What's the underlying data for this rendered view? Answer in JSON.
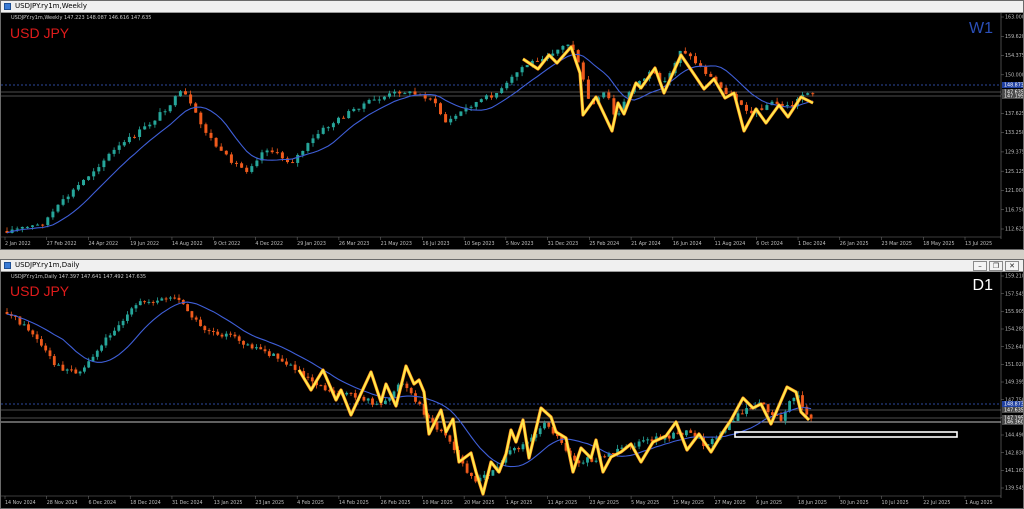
{
  "weekly": {
    "title": "USDJPY.ry1m,Weekly",
    "info": "USDJPY.ry1m,Weekly  147.223 148.087 146.616 147.635",
    "symbol": "USD JPY",
    "timeframe": "W1",
    "timeframe_color": "#2b4fb8",
    "price_labels": [
      "163.000",
      "159.620",
      "154.375",
      "150.000",
      "142.000",
      "137.625",
      "133.250",
      "129.375",
      "125.125",
      "121.000",
      "116.750",
      "112.625"
    ],
    "date_labels": [
      "2 Jan 2022",
      "27 Feb 2022",
      "24 Apr 2022",
      "19 Jun 2022",
      "14 Aug 2022",
      "9 Oct 2022",
      "4 Dec 2022",
      "29 Jan 2023",
      "26 Mar 2023",
      "21 May 2023",
      "16 Jul 2023",
      "10 Sep 2023",
      "5 Nov 2023",
      "31 Dec 2023",
      "25 Feb 2024",
      "21 Apr 2024",
      "16 Jun 2024",
      "11 Aug 2024",
      "6 Oct 2024",
      "1 Dec 2024",
      "26 Jan 2025",
      "23 Mar 2025",
      "18 May 2025",
      "13 Jul 2025"
    ],
    "tags": [
      {
        "text": "148.873",
        "color": "#1e3fa0"
      },
      {
        "text": "147.635",
        "color": "#4a4a4a"
      },
      {
        "text": "147.195",
        "color": "#4a4a4a"
      }
    ]
  },
  "daily": {
    "title": "USDJPY.ry1m,Daily",
    "info": "USDJPY.ry1m,Daily  147.397 147.641 147.492 147.635",
    "symbol": "USD JPY",
    "timeframe": "D1",
    "timeframe_color": "#ffffff",
    "window_buttons": [
      "–",
      "❐",
      "✕"
    ],
    "price_labels": [
      "159.210",
      "157.545",
      "155.905",
      "154.285",
      "152.640",
      "151.020",
      "149.395",
      "147.750",
      "146.130",
      "144.490",
      "142.830",
      "141.165",
      "139.545"
    ],
    "date_labels": [
      "14 Nov 2024",
      "28 Nov 2024",
      "6 Dec 2024",
      "18 Dec 2024",
      "31 Dec 2024",
      "13 Jan 2025",
      "23 Jan 2025",
      "4 Feb 2025",
      "14 Feb 2025",
      "26 Feb 2025",
      "10 Mar 2025",
      "20 Mar 2025",
      "1 Apr 2025",
      "11 Apr 2025",
      "23 Apr 2025",
      "5 May 2025",
      "15 May 2025",
      "27 May 2025",
      "6 Jun 2025",
      "18 Jun 2025",
      "30 Jun 2025",
      "10 Jul 2025",
      "22 Jul 2025",
      "1 Aug 2025"
    ],
    "tags": [
      {
        "text": "148.873",
        "color": "#1e3fa0"
      },
      {
        "text": "147.635",
        "color": "#4a4a4a"
      },
      {
        "text": "147.195",
        "color": "#4a4a4a"
      },
      {
        "text": "146.360",
        "color": "#4a4a4a"
      }
    ]
  },
  "colors": {
    "bull": "#26a69a",
    "bear": "#ef5a1c",
    "ma": "#3f5fd8",
    "zigzag": "#ffe84d",
    "zigzag_edge": "#ff8c1a",
    "box": "#ffffff"
  }
}
